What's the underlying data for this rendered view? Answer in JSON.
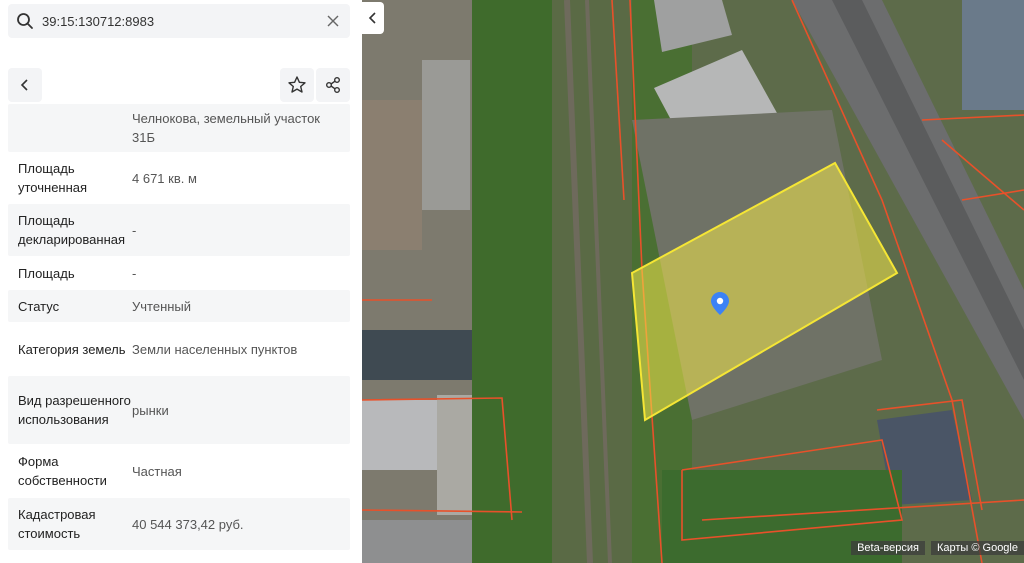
{
  "search": {
    "value": "39:15:130712:8983",
    "placeholder": ""
  },
  "properties": [
    {
      "label": "",
      "value": "Челнокова, земельный участок 31Б"
    },
    {
      "label": "Площадь уточненная",
      "value": "4 671 кв. м"
    },
    {
      "label": "Площадь декларированная",
      "value": "-"
    },
    {
      "label": "Площадь",
      "value": "-"
    },
    {
      "label": "Статус",
      "value": "Учтенный"
    },
    {
      "label": "Категория земель",
      "value": "Земли населенных пунктов"
    },
    {
      "label": "Вид разрешенного использования",
      "value": "рынки"
    },
    {
      "label": "Форма собственности",
      "value": "Частная"
    },
    {
      "label": "Кадастровая стоимость",
      "value": "40 544 373,42 руб."
    }
  ],
  "map": {
    "beta_label": "Beta-версия",
    "provider_label": "Карты © Google",
    "parcel_fill": "#f2e84b",
    "parcel_stroke": "#f5e635",
    "boundary_color": "#e8512a",
    "marker_color": "#3b82f6"
  },
  "icons": {
    "search": "search-icon",
    "clear": "close-icon",
    "back": "chevron-left-icon",
    "favorite": "star-icon",
    "share": "share-icon",
    "collapse": "chevron-left-icon"
  }
}
